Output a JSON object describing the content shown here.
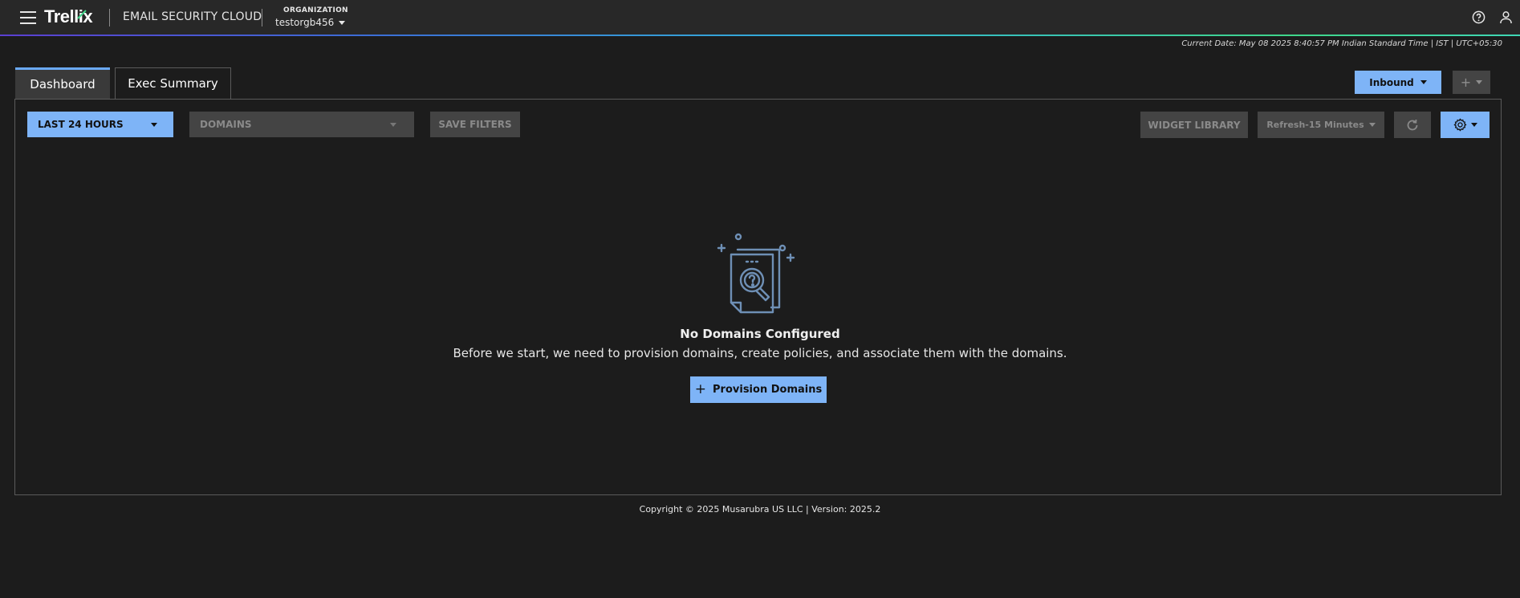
{
  "header": {
    "logo_text": "Trellix",
    "product_name": "EMAIL SECURITY CLOUD",
    "org_label": "ORGANIZATION",
    "org_value": "testorgb456",
    "accent_color": "#3fd68a"
  },
  "current_date": "Current Date: May 08 2025 8:40:57 PM Indian Standard Time | IST | UTC+05:30",
  "tabs": [
    {
      "label": "Dashboard",
      "active": true
    },
    {
      "label": "Exec Summary",
      "active": false
    }
  ],
  "direction_select": {
    "label": "Inbound"
  },
  "filters": {
    "time_range": "LAST 24 HOURS",
    "domains_placeholder": "DOMAINS",
    "save_label": "SAVE FILTERS"
  },
  "toolbar": {
    "widget_library": "WIDGET LIBRARY",
    "refresh_interval": "Refresh-15 Minutes"
  },
  "empty_state": {
    "title": "No Domains Configured",
    "description": "Before we start, we need to provision domains, create policies, and associate them with the domains.",
    "button_label": "Provision Domains"
  },
  "footer": {
    "text": "Copyright © 2025 Musarubra US LLC | Version: 2025.2"
  },
  "colors": {
    "primary": "#7eb4f7",
    "background": "#1c1c1c",
    "topbar": "#282828",
    "disabled": "#444444"
  }
}
